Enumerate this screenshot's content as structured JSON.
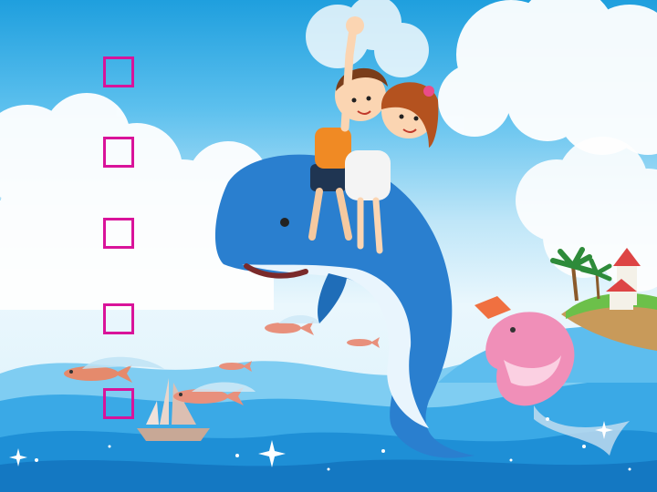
{
  "title": {
    "glyphs": [
      "□",
      "□",
      "□",
      "□",
      "□"
    ],
    "color": "#d9139a"
  },
  "scene": {
    "sky_color": "#1f9fde",
    "sea_color": "#1e8fd6",
    "dolphin_color": "#2a7fcf",
    "pink_dolphin_color": "#f08fb8",
    "elements": [
      "clouds",
      "dolphin-with-children",
      "pink-dolphin",
      "flying-fish",
      "sailboat",
      "island-with-palms",
      "waves",
      "sparkles"
    ]
  }
}
